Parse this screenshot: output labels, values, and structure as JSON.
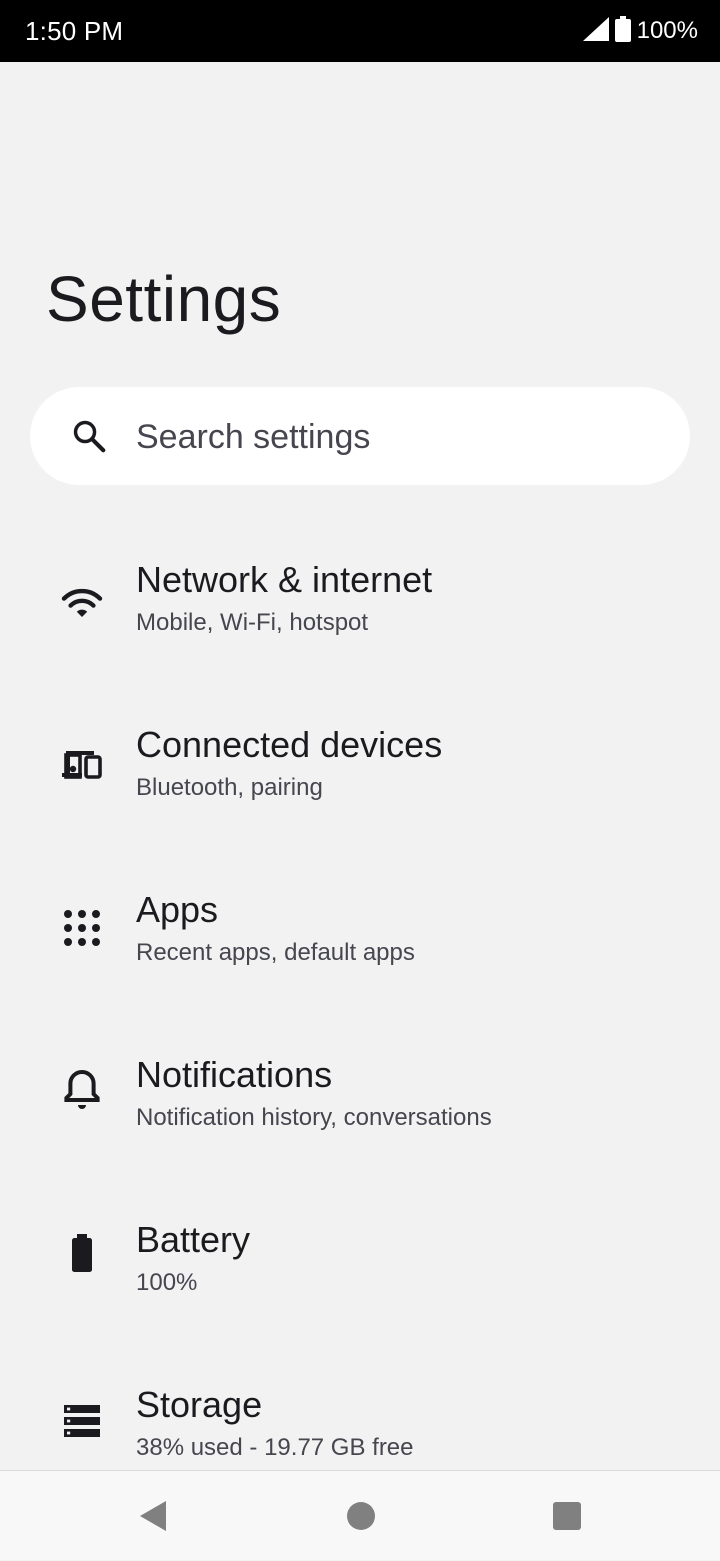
{
  "status_bar": {
    "time": "1:50 PM",
    "battery_text": "100%",
    "signal_icon": "cellular-signal-icon",
    "battery_icon": "battery-full-icon"
  },
  "page": {
    "title": "Settings"
  },
  "search": {
    "placeholder": "Search settings",
    "icon": "search-icon"
  },
  "items": [
    {
      "title": "Network & internet",
      "subtitle": "Mobile, Wi-Fi, hotspot",
      "icon": "wifi-icon"
    },
    {
      "title": "Connected devices",
      "subtitle": "Bluetooth, pairing",
      "icon": "connected-devices-icon"
    },
    {
      "title": "Apps",
      "subtitle": "Recent apps, default apps",
      "icon": "apps-grid-icon"
    },
    {
      "title": "Notifications",
      "subtitle": "Notification history, conversations",
      "icon": "bell-icon"
    },
    {
      "title": "Battery",
      "subtitle": "100%",
      "icon": "battery-icon"
    },
    {
      "title": "Storage",
      "subtitle": "38% used - 19.77 GB free",
      "icon": "storage-icon"
    }
  ],
  "nav": {
    "back_icon": "back-triangle-icon",
    "home_icon": "home-circle-icon",
    "recents_icon": "recents-square-icon"
  }
}
